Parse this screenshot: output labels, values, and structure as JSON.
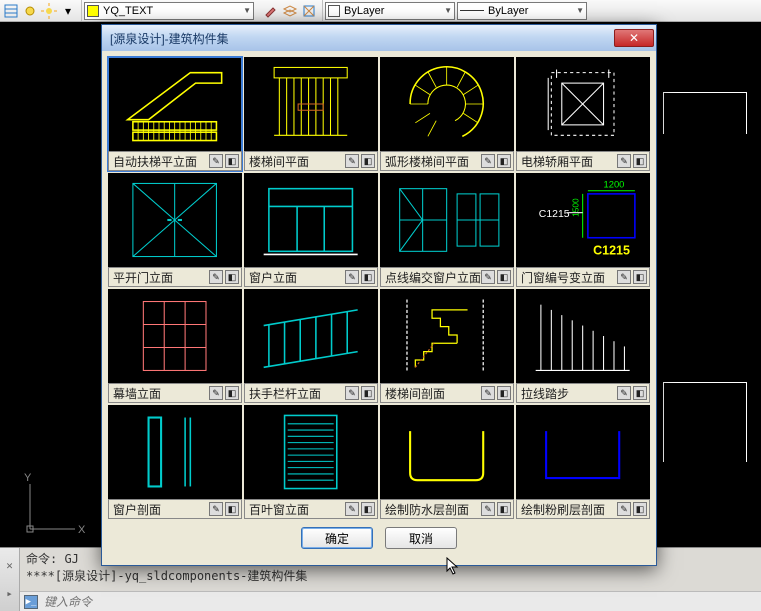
{
  "toolbar": {
    "layer_name": "YQ_TEXT",
    "bylayer_label": "ByLayer",
    "linetype_label": "ByLayer"
  },
  "dialog": {
    "title": "[源泉设计]-建筑构件集",
    "ok": "确定",
    "cancel": "取消",
    "items": [
      "自动扶梯平立面",
      "楼梯间平面",
      "弧形楼梯间平面",
      "电梯轿厢平面",
      "平开门立面",
      "窗户立面",
      "点线编交窗户立面",
      "门窗编号变立面",
      "幕墙立面",
      "扶手栏杆立面",
      "楼梯间剖面",
      "拉线踏步",
      "窗户剖面",
      "百叶窗立面",
      "绘制防水层剖面",
      "绘制粉刷层剖面"
    ],
    "c1215": "C1215",
    "c1215_dim": "1200",
    "c1215_dim2": "1500"
  },
  "ucs": {
    "x": "X",
    "y": "Y"
  },
  "cmd": {
    "line1": "命令: GJ",
    "line2": "****[源泉设计]-yq_sldcomponents-建筑构件集",
    "placeholder": "键入命令"
  }
}
